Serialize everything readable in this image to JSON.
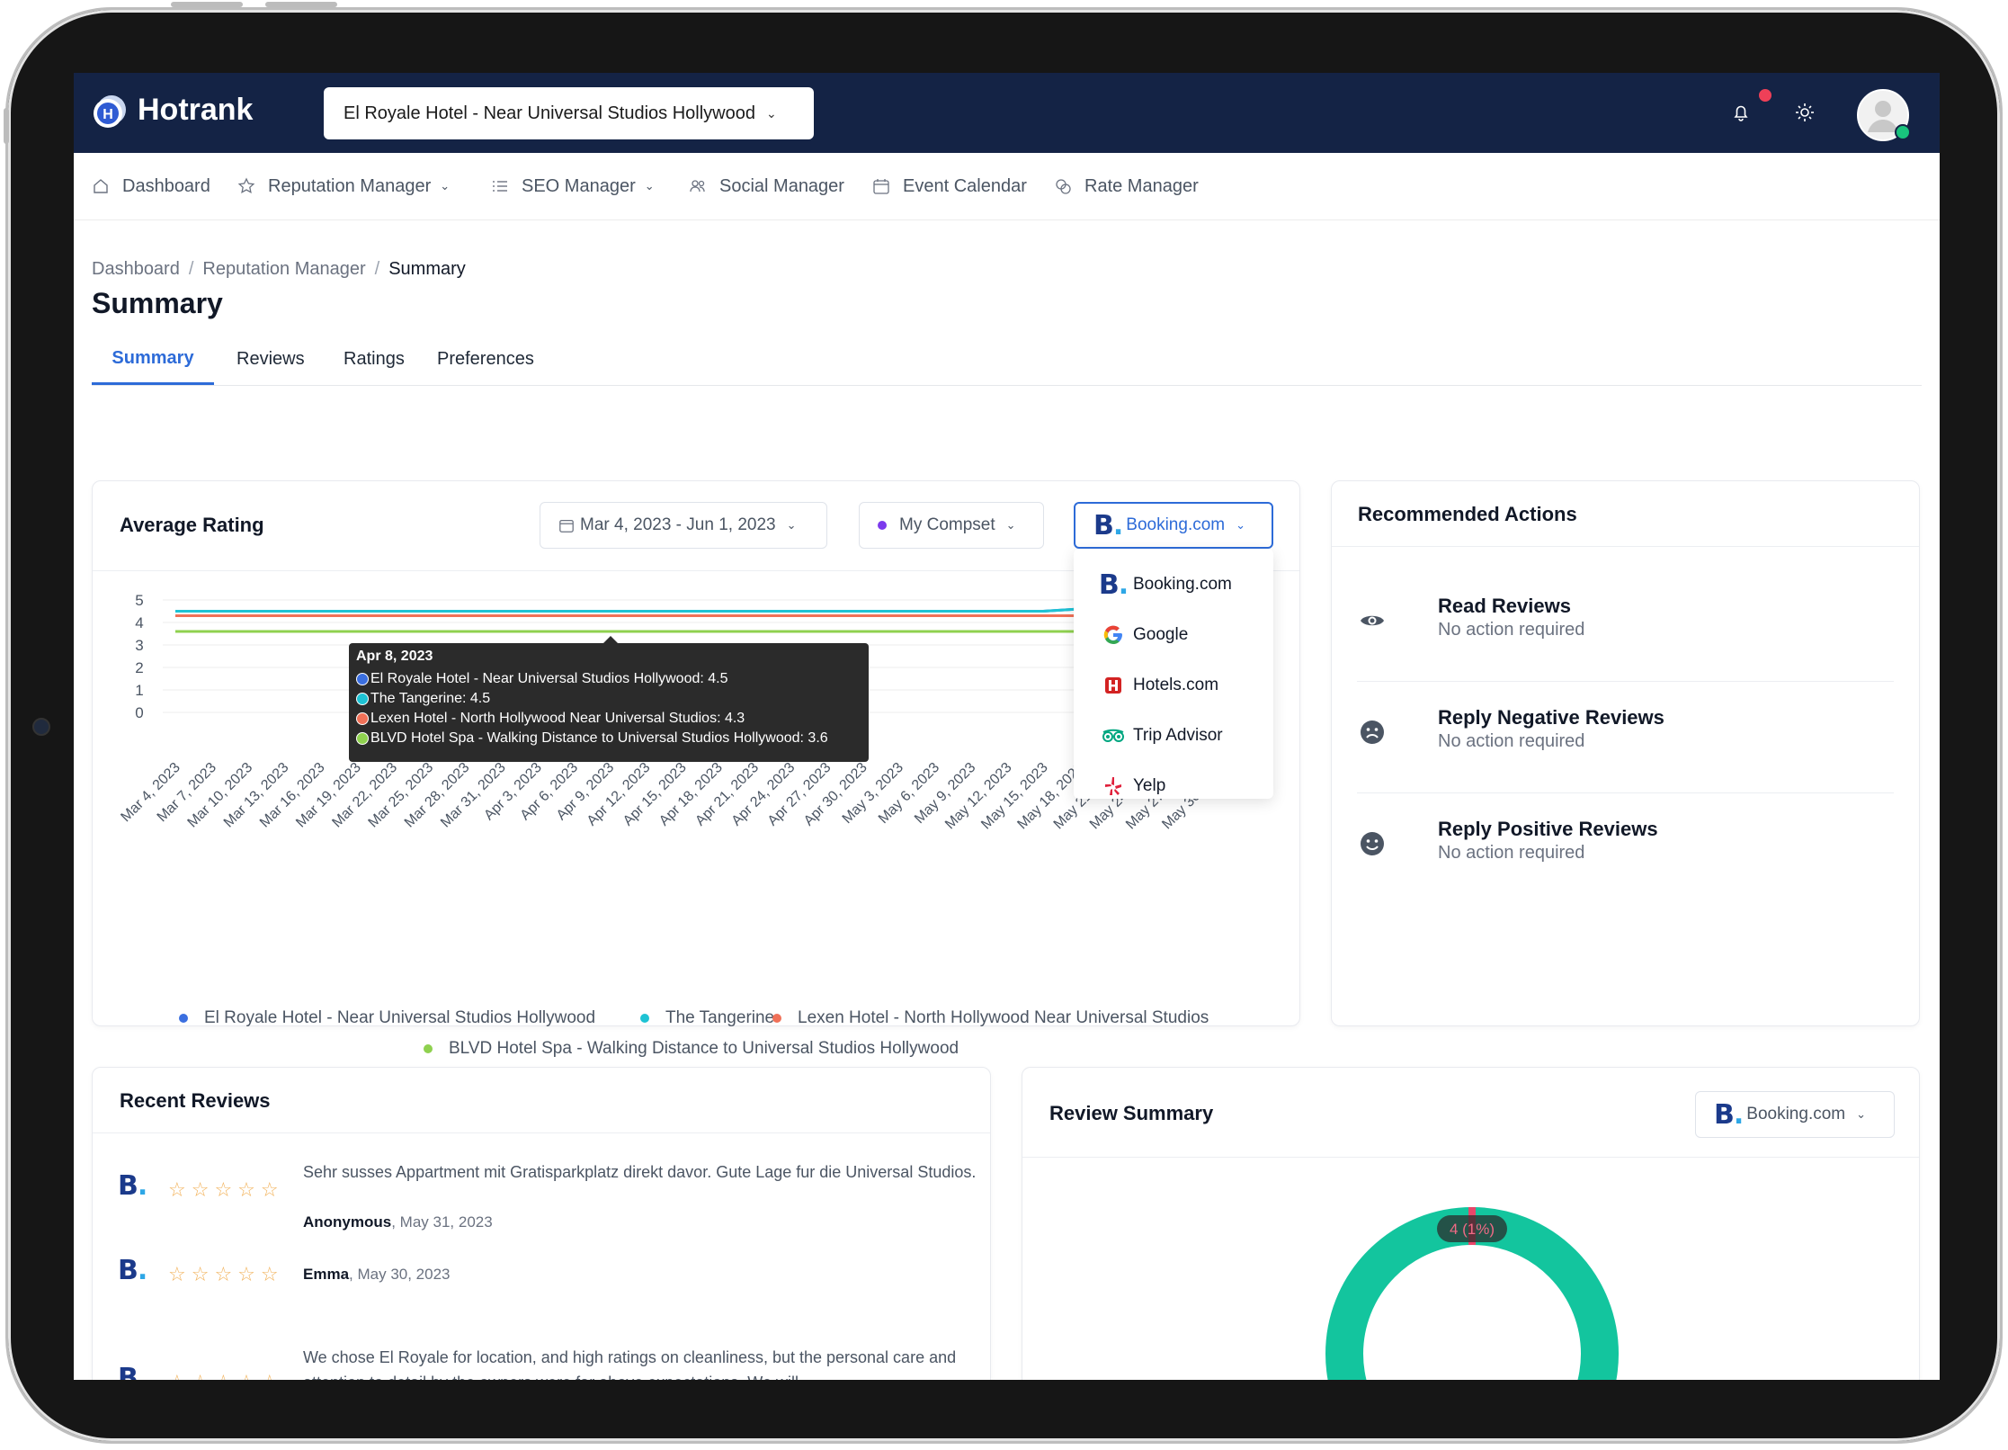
{
  "app": {
    "name": "Hotrank",
    "hotel": "El Royale Hotel - Near Universal Studios Hollywood"
  },
  "nav": [
    {
      "label": "Dashboard",
      "icon": "home-icon",
      "dropdown": false
    },
    {
      "label": "Reputation Manager",
      "icon": "star-outline-icon",
      "dropdown": true
    },
    {
      "label": "SEO Manager",
      "icon": "list-icon",
      "dropdown": true
    },
    {
      "label": "Social Manager",
      "icon": "users-icon",
      "dropdown": false
    },
    {
      "label": "Event Calendar",
      "icon": "calendar-icon",
      "dropdown": false
    },
    {
      "label": "Rate Manager",
      "icon": "coins-icon",
      "dropdown": false
    }
  ],
  "breadcrumb": {
    "items": [
      "Dashboard",
      "Reputation Manager"
    ],
    "current": "Summary"
  },
  "page": {
    "title": "Summary"
  },
  "tabs": [
    "Summary",
    "Reviews",
    "Ratings",
    "Preferences"
  ],
  "average_rating": {
    "title": "Average Rating",
    "date_range": "Mar 4, 2023 - Jun 1, 2023",
    "compset": "My Compset",
    "source": "Booking.com",
    "dropdown_options": [
      "Booking.com",
      "Google",
      "Hotels.com",
      "Trip Advisor",
      "Yelp"
    ],
    "tooltip": {
      "date": "Apr 8, 2023",
      "rows": [
        "El Royale Hotel - Near Universal Studios Hollywood: 4.5",
        "The Tangerine: 4.5",
        "Lexen Hotel - North Hollywood Near Universal Studios: 4.3",
        "BLVD Hotel  Spa - Walking Distance to Universal Studios Hollywood: 3.6"
      ]
    }
  },
  "chart_data": {
    "type": "line",
    "x": [
      "Mar 4, 2023",
      "Mar 7, 2023",
      "Mar 10, 2023",
      "Mar 13, 2023",
      "Mar 16, 2023",
      "Mar 19, 2023",
      "Mar 22, 2023",
      "Mar 25, 2023",
      "Mar 28, 2023",
      "Mar 31, 2023",
      "Apr 3, 2023",
      "Apr 6, 2023",
      "Apr 9, 2023",
      "Apr 12, 2023",
      "Apr 15, 2023",
      "Apr 18, 2023",
      "Apr 21, 2023",
      "Apr 24, 2023",
      "Apr 27, 2023",
      "Apr 30, 2023",
      "May 3, 2023",
      "May 6, 2023",
      "May 9, 2023",
      "May 12, 2023",
      "May 15, 2023",
      "May 18, 2023",
      "May 21, 2023",
      "May 24, 2023",
      "May 27, 2023",
      "May 30, 2023"
    ],
    "x_tick_labels": [
      "Mar 4, 2023",
      "Mar 7, 2023",
      "Mar 10, 2023",
      "Mar 13, 2023",
      "Mar 16, 2023",
      "Mar 19, 2023",
      "Mar 22, 2023",
      "Mar 25, 2023",
      "Mar 28, 2023",
      "Mar 31, 2023",
      "Apr 3, 2023",
      "Apr 6, 2023",
      "Apr 9, 2023",
      "Apr 12, 2023",
      "Apr 15, 2023",
      "Apr 18, 2023",
      "Apr 21, 2023",
      "Apr 24, 2023",
      "Apr 27, 2023",
      "Apr 30, 2023",
      "May 3, 2023",
      "May 6, 2023",
      "May 9, 2023",
      "May 12, 2023",
      "May 15, 2023",
      "May 18, 2023",
      "May 21, 2023",
      "May 24, 2023",
      "May 27, 2023",
      "May 30, 2023"
    ],
    "y_ticks": [
      "0",
      "1",
      "2",
      "3",
      "4",
      "5"
    ],
    "ylim": [
      0,
      5
    ],
    "series": [
      {
        "name": "El Royale Hotel - Near Universal Studios Hollywood",
        "color": "#3b6fe0",
        "values": [
          4.5,
          4.5,
          4.5,
          4.5,
          4.5,
          4.5,
          4.5,
          4.5,
          4.5,
          4.5,
          4.5,
          4.5,
          4.5,
          4.5,
          4.5,
          4.5,
          4.5,
          4.5,
          4.5,
          4.5,
          4.5,
          4.5,
          4.5,
          4.5,
          4.5,
          4.6,
          4.6,
          4.6,
          4.6,
          4.6
        ]
      },
      {
        "name": "The Tangerine",
        "color": "#1ec3d4",
        "values": [
          4.5,
          4.5,
          4.5,
          4.5,
          4.5,
          4.5,
          4.5,
          4.5,
          4.5,
          4.5,
          4.5,
          4.5,
          4.5,
          4.5,
          4.5,
          4.5,
          4.5,
          4.5,
          4.5,
          4.5,
          4.5,
          4.5,
          4.5,
          4.5,
          4.5,
          4.6,
          4.6,
          4.6,
          4.6,
          4.6
        ]
      },
      {
        "name": "Lexen Hotel - North Hollywood Near Universal Studios",
        "color": "#f07158",
        "values": [
          4.3,
          4.3,
          4.3,
          4.3,
          4.3,
          4.3,
          4.3,
          4.3,
          4.3,
          4.3,
          4.3,
          4.3,
          4.3,
          4.3,
          4.3,
          4.3,
          4.3,
          4.3,
          4.3,
          4.3,
          4.3,
          4.3,
          4.3,
          4.3,
          4.3,
          4.3,
          4.3,
          4.3,
          4.3,
          4.3
        ]
      },
      {
        "name": "BLVD Hotel  Spa - Walking Distance to Universal Studios Hollywood",
        "color": "#8fd14f",
        "values": [
          3.6,
          3.6,
          3.6,
          3.6,
          3.6,
          3.6,
          3.6,
          3.6,
          3.6,
          3.6,
          3.6,
          3.6,
          3.6,
          3.6,
          3.6,
          3.6,
          3.6,
          3.6,
          3.6,
          3.6,
          3.6,
          3.6,
          3.6,
          3.6,
          3.6,
          3.6,
          3.6,
          3.6,
          3.6,
          3.6
        ]
      }
    ],
    "legend": "bottom",
    "grid": true
  },
  "recommended": {
    "title": "Recommended Actions",
    "items": [
      {
        "title": "Read Reviews",
        "status": "No action required",
        "icon": "eye-icon"
      },
      {
        "title": "Reply Negative Reviews",
        "status": "No action required",
        "icon": "sad-face-icon"
      },
      {
        "title": "Reply Positive Reviews",
        "status": "No action required",
        "icon": "happy-face-icon"
      }
    ]
  },
  "recent_reviews": {
    "title": "Recent Reviews",
    "items": [
      {
        "text": "Sehr susses Appartment mit Gratisparkplatz direkt davor. Gute Lage fur die Universal Studios.",
        "author": "Anonymous",
        "date": ", May 31, 2023"
      },
      {
        "text": "",
        "author": "Emma",
        "date": ", May 30, 2023"
      },
      {
        "text": "We chose El Royale for location, and high ratings on cleanliness, but the personal care and attention to detail by the owners were far above expectations. We will",
        "author": "",
        "date": ""
      }
    ]
  },
  "review_summary": {
    "title": "Review Summary",
    "source": "Booking.com",
    "donut_label": "4 (1%)",
    "colors": {
      "main": "#13c59e",
      "highlight": "#e8466a"
    }
  }
}
